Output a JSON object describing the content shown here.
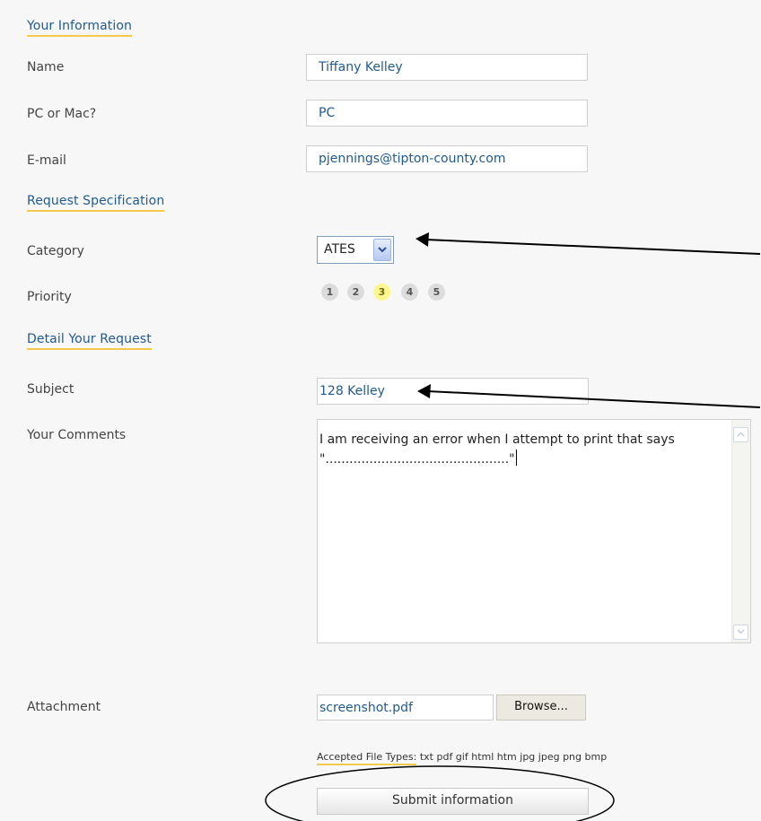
{
  "your_information": {
    "title": "Your Information",
    "name": {
      "label": "Name",
      "value": "Tiffany Kelley"
    },
    "pc_or_mac": {
      "label": "PC or Mac?",
      "value": "PC"
    },
    "email": {
      "label": "E-mail",
      "value": "pjennings@tipton-county.com"
    }
  },
  "request_specification": {
    "title": "Request Specification",
    "category": {
      "label": "Category",
      "value": "ATES"
    },
    "priority": {
      "label": "Priority",
      "options": [
        "1",
        "2",
        "3",
        "4",
        "5"
      ],
      "selected": "3"
    }
  },
  "detail_request": {
    "title": "Detail Your Request",
    "subject": {
      "label": "Subject",
      "value": "128 Kelley"
    },
    "comments": {
      "label": "Your Comments",
      "value": "I am receiving an error when I attempt to print that says \"..............................................\""
    }
  },
  "attachment": {
    "label": "Attachment",
    "file": "screenshot.pdf",
    "browse_label": "Browse...",
    "accepted_label": "Accepted File Types:",
    "accepted_types": "txt pdf gif html htm jpg jpeg png bmp"
  },
  "submit_label": "Submit information",
  "colors": {
    "accent": "#1f5a92",
    "underline": "#f2c94c",
    "selected_priority": "#fdf78d"
  }
}
